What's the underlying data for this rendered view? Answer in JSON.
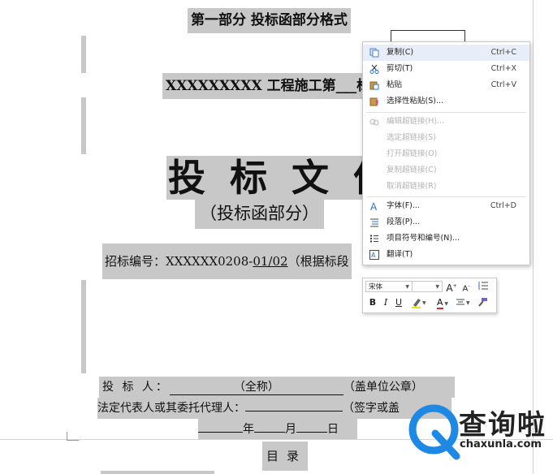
{
  "document": {
    "heading": "第一部分 投标函部分格式",
    "project_title": "XXXXXXXXX 工程施工第___标",
    "big_title": "投标文件",
    "subtitle": "（投标函部分）",
    "code_prefix": "招标编号：XXXXXX0208-",
    "code_value": "01/02",
    "code_suffix": "（根据标段",
    "sig1_label": "投 标 人：",
    "sig1_blank_text": "（全称）",
    "sig1_note": "（盖单位公章）",
    "sig2_label": "法定代表人或其委托代理人：",
    "sig2_note": "（签字或盖",
    "date_year": "年",
    "date_month": "月",
    "date_day": "日",
    "toc": "目录"
  },
  "context_menu": {
    "items": [
      {
        "label": "复制(C)",
        "shortcut": "Ctrl+C",
        "icon": "copy-icon",
        "enabled": true
      },
      {
        "label": "剪切(T)",
        "shortcut": "Ctrl+X",
        "icon": "cut-icon",
        "enabled": true
      },
      {
        "label": "粘贴",
        "shortcut": "Ctrl+V",
        "icon": "paste-icon",
        "enabled": true
      },
      {
        "label": "选择性粘贴(S)...",
        "shortcut": "",
        "icon": "paste-special-icon",
        "enabled": true
      },
      {
        "label": "编辑超链接(H)...",
        "shortcut": "",
        "icon": "hyperlink-icon",
        "enabled": false
      },
      {
        "label": "选定超链接(S)",
        "shortcut": "",
        "icon": "",
        "enabled": false
      },
      {
        "label": "打开超链接(O)",
        "shortcut": "",
        "icon": "",
        "enabled": false
      },
      {
        "label": "复制超链接(C)",
        "shortcut": "",
        "icon": "",
        "enabled": false
      },
      {
        "label": "取消超链接(R)",
        "shortcut": "",
        "icon": "",
        "enabled": false
      },
      {
        "label": "字体(F)...",
        "shortcut": "Ctrl+D",
        "icon": "font-icon",
        "enabled": true
      },
      {
        "label": "段落(P)...",
        "shortcut": "",
        "icon": "paragraph-icon",
        "enabled": true
      },
      {
        "label": "项目符号和编号(N)...",
        "shortcut": "",
        "icon": "bullets-icon",
        "enabled": true
      },
      {
        "label": "翻译(T)",
        "shortcut": "",
        "icon": "translate-icon",
        "enabled": true
      }
    ]
  },
  "mini_toolbar": {
    "font_name": "宋体",
    "font_size": "",
    "grow_font": "A",
    "shrink_font": "A",
    "bold": "B",
    "italic": "I",
    "underline": "U",
    "font_color": "A"
  },
  "watermark": {
    "brand": "查询啦",
    "url": "chaxunla.com"
  },
  "colors": {
    "highlight": "#c8c8c8",
    "menu_active": "#e8eef9",
    "watermark_blue": "#1e88e5",
    "disabled_text": "#b4b4b4"
  }
}
